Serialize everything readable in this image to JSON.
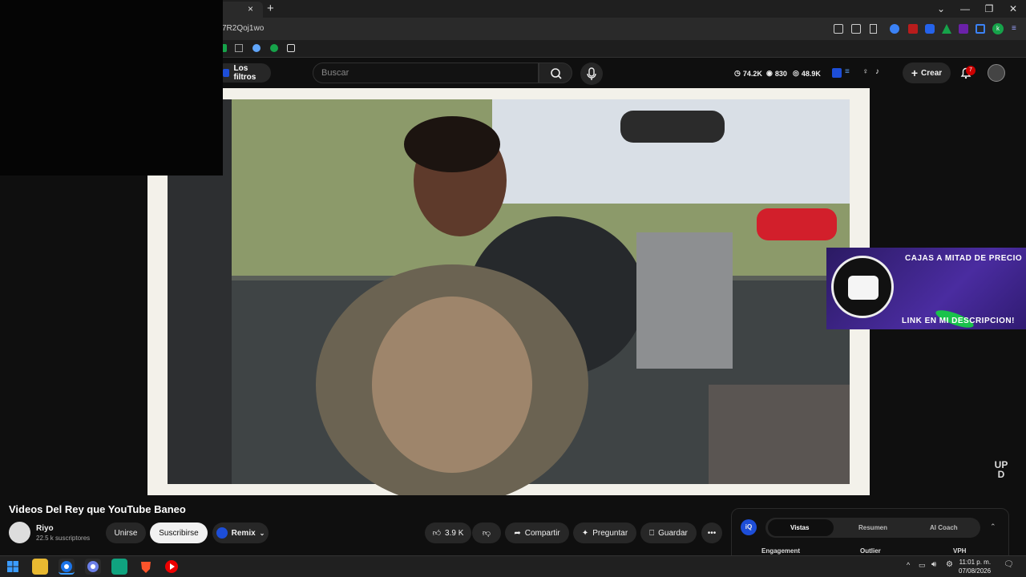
{
  "browser": {
    "url_fragment": "7R2Qoj1wo",
    "tab_close": "×",
    "new_tab": "+"
  },
  "header": {
    "filters_label": "Los filtros",
    "search_placeholder": "Buscar",
    "stats": {
      "views": "74.2K",
      "likes": "830",
      "watch": "48.9K"
    },
    "create_label": "Crear",
    "notif_count": "7"
  },
  "video": {
    "promo_top": "CAJAS A MITAD DE PRECIO",
    "promo_bottom": "LINK EN MI DESCRIPCION!",
    "watermark": "UP D"
  },
  "below": {
    "title": "Videos Del Rey que YouTube Baneo",
    "channel_name": "Riyo",
    "channel_subs": "22.5 k suscriptores",
    "join_label": "Unirse",
    "subscribe_label": "Suscribirse",
    "remix_label": "Remix",
    "like_count": "3.9 K",
    "share_label": "Compartir",
    "ask_label": "Preguntar",
    "save_label": "Guardar"
  },
  "panel": {
    "badge": "iQ",
    "tabs": [
      "Vistas",
      "Resumen",
      "AI Coach"
    ],
    "headers": [
      "Engagement",
      "Outlier",
      "VPH"
    ]
  },
  "taskbar": {
    "time": "11:01 p. m.",
    "date": "07/08/2026",
    "chevron": "^"
  },
  "colors": {
    "accent": "#cc0000",
    "subscribe_bg": "#f1f1f1",
    "panel_bg": "#111111"
  }
}
